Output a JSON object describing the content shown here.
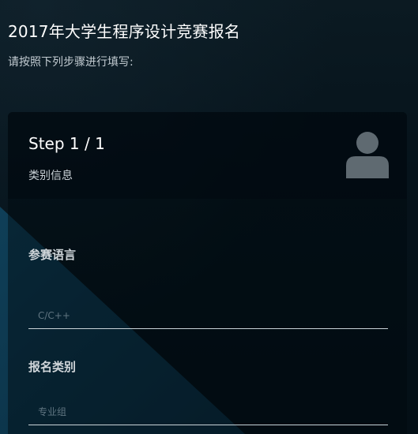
{
  "page": {
    "title": "2017年大学生程序设计竞赛报名",
    "subtitle": "请按照下列步骤进行填写:"
  },
  "step": {
    "title": "Step 1 / 1",
    "subtitle": "类别信息",
    "icon": "user-icon"
  },
  "form": {
    "fields": [
      {
        "label": "参赛语言",
        "placeholder": "C/C++",
        "value": ""
      },
      {
        "label": "报名类别",
        "placeholder": "专业组",
        "value": ""
      }
    ]
  },
  "colors": {
    "background": "#041018",
    "accent_panel": "#0d3a52",
    "icon": "#5f6a71",
    "input_border": "#c9d3d8"
  }
}
